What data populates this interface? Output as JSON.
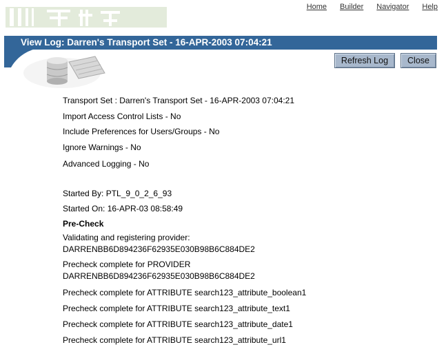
{
  "nav": {
    "links": [
      "Home",
      "Builder",
      "Navigator",
      "Help"
    ]
  },
  "header": {
    "title": "View Log: Darren's Transport Set - 16-APR-2003 07:04:21"
  },
  "toolbar": {
    "refresh_label": "Refresh Log",
    "close_label": "Close"
  },
  "log": {
    "transport_set": "Transport Set : Darren's Transport Set - 16-APR-2003 07:04:21",
    "import_acl": "Import Access Control Lists - No",
    "include_prefs": "Include Preferences for Users/Groups - No",
    "ignore_warnings": "Ignore Warnings - No",
    "advanced_logging": "Advanced Logging - No",
    "started_by": "Started By: PTL_9_0_2_6_93",
    "started_on": "Started On: 16-APR-03 08:58:49",
    "section_heading": "Pre-Check",
    "entries": [
      "Validating and registering provider:",
      "DARRENBB6D894236F62935E030B98B6C884DE2",
      "Precheck complete for PROVIDER",
      "DARRENBB6D894236F62935E030B98B6C884DE2",
      "Precheck complete for ATTRIBUTE search123_attribute_boolean1",
      "Precheck complete for ATTRIBUTE search123_attribute_text1",
      "Precheck complete for ATTRIBUTE search123_attribute_date1",
      "Precheck complete for ATTRIBUTE search123_attribute_url1"
    ]
  },
  "colors": {
    "title_bar": "#336699",
    "button_bg": "#a8b8cc",
    "logo_green": "#dfe8d6"
  }
}
